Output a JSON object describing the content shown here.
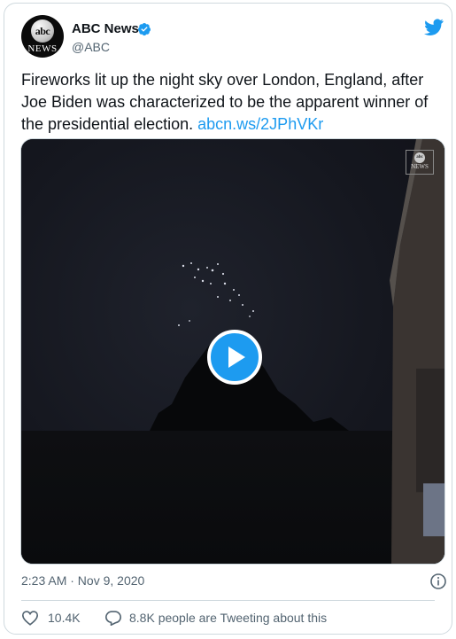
{
  "account": {
    "name": "ABC News",
    "handle": "@ABC",
    "avatar_top": "abc",
    "avatar_bottom": "NEWS"
  },
  "tweet": {
    "text": "Fireworks lit up the night sky over London, England, after Joe Biden was characterized to be the apparent winner of the presidential election.",
    "link": "abcn.ws/2JPhVKr"
  },
  "media": {
    "watermark_top": "abc",
    "watermark_bottom": "NEWS"
  },
  "meta": {
    "timestamp": "2:23 AM · Nov 9, 2020"
  },
  "actions": {
    "likes": "10.4K",
    "tweeting": "8.8K people are Tweeting about this"
  },
  "icons": [
    "verified-badge-icon",
    "twitter-bird-icon",
    "play-icon",
    "info-icon",
    "heart-icon",
    "reply-icon"
  ],
  "colors": {
    "accent": "#1d9bf0",
    "muted": "#536471",
    "border": "#cfd9de"
  }
}
